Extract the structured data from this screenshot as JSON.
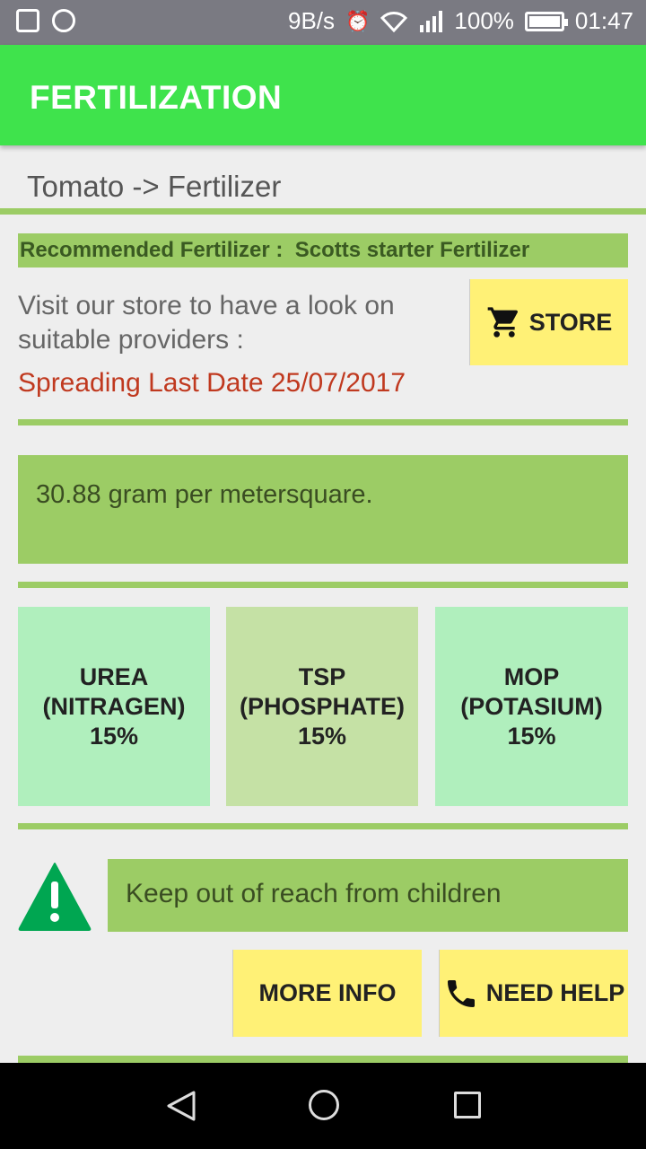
{
  "status_bar": {
    "speed": "9B/s",
    "battery": "100%",
    "time": "01:47"
  },
  "app_bar": {
    "title": "FERTILIZATION"
  },
  "breadcrumb": "Tomato -> Fertilizer",
  "recommendation": {
    "label": "Recommended Fertilizer :",
    "value": "Scotts starter Fertilizer"
  },
  "store": {
    "visit_text": "Visit our store to have a look on suitable providers :",
    "button_label": "STORE"
  },
  "spreading": "Spreading Last Date 25/07/2017",
  "amount": "30.88 gram per metersquare.",
  "nutrients": [
    {
      "name": "UREA",
      "sub": "(NITRAGEN)",
      "pct": "15%"
    },
    {
      "name": "TSP",
      "sub": "(PHOSPHATE)",
      "pct": "15%"
    },
    {
      "name": "MOP",
      "sub": "(POTASIUM)",
      "pct": "15%"
    }
  ],
  "warning": "Keep out of reach from children",
  "buttons": {
    "more_info": "MORE INFO",
    "need_help": "NEED HELP"
  },
  "colors": {
    "app_bar": "#3fe34c",
    "accent_green": "#9ccc65",
    "button_yellow": "#fff176",
    "date_red": "#c0391f"
  }
}
